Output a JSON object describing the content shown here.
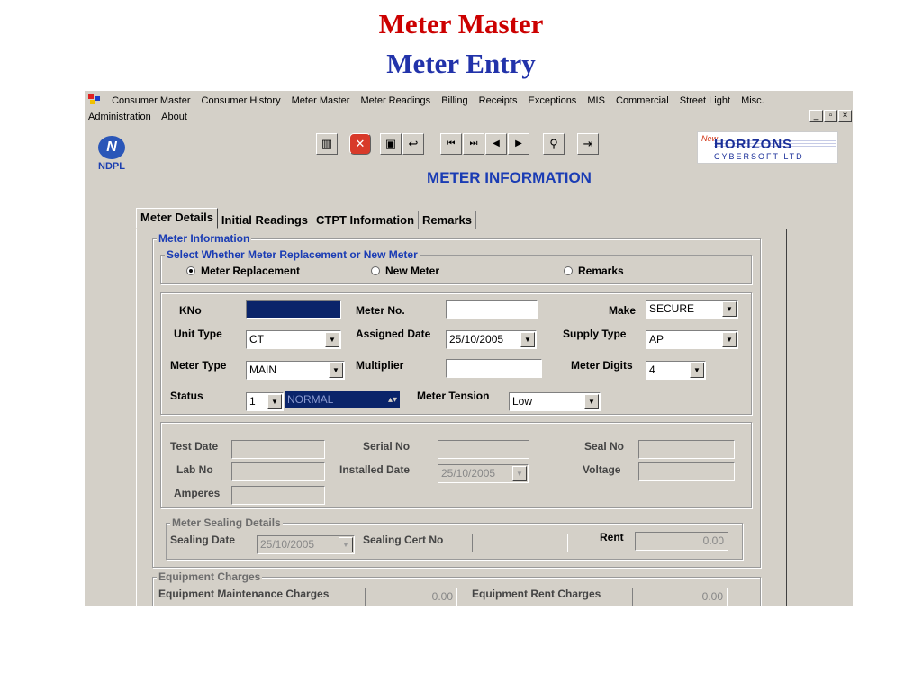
{
  "slide": {
    "title": "Meter Master",
    "subtitle": "Meter Entry"
  },
  "menu": {
    "row1": [
      "Consumer Master",
      "Consumer History",
      "Meter Master",
      "Meter Readings",
      "Billing",
      "Receipts",
      "Exceptions",
      "MIS",
      "Commercial",
      "Street Light",
      "Misc."
    ],
    "row2": [
      "Administration",
      "About"
    ]
  },
  "window_buttons": {
    "minimize": "_",
    "restore": "▫",
    "close": "×"
  },
  "logo": {
    "ndpl": "NDPL",
    "horizons_new": "New",
    "horizons": "HORIZONS",
    "horizons_sub": "CYBERSOFT LTD"
  },
  "heading": "METER INFORMATION",
  "tabs": [
    "Meter Details",
    "Initial Readings",
    "CTPT Information",
    "Remarks"
  ],
  "meter_info": {
    "legend": "Meter Information",
    "select_legend": "Select Whether Meter Replacement or New Meter",
    "options": [
      "Meter Replacement",
      "New Meter",
      "Remarks"
    ],
    "selected_option": "Meter Replacement"
  },
  "fields": {
    "kno_label": "KNo",
    "meter_no_label": "Meter No.",
    "make_label": "Make",
    "make_value": "SECURE",
    "unit_type_label": "Unit Type",
    "unit_type_value": "CT",
    "assigned_date_label": "Assigned Date",
    "assigned_date_value": "25/10/2005",
    "supply_type_label": "Supply Type",
    "supply_type_value": "AP",
    "meter_type_label": "Meter Type",
    "meter_type_value": "MAIN",
    "multiplier_label": "Multiplier",
    "meter_digits_label": "Meter Digits",
    "meter_digits_value": "4",
    "status_label": "Status",
    "status_code": "1",
    "status_value": "NORMAL",
    "meter_tension_label": "Meter Tension",
    "meter_tension_value": "Low"
  },
  "test": {
    "test_date_label": "Test Date",
    "serial_no_label": "Serial No",
    "seal_no_label": "Seal No",
    "lab_no_label": "Lab No",
    "installed_date_label": "Installed Date",
    "installed_date_value": "25/10/2005",
    "voltage_label": "Voltage",
    "amperes_label": "Amperes"
  },
  "sealing": {
    "legend": "Meter Sealing Details",
    "sealing_date_label": "Sealing Date",
    "sealing_date_value": "25/10/2005",
    "sealing_cert_label": "Sealing Cert No",
    "rent_label": "Rent",
    "rent_value": "0.00"
  },
  "equipment": {
    "legend": "Equipment Charges",
    "maintenance_label": "Equipment Maintenance Charges",
    "maintenance_value": "0.00",
    "rent_label": "Equipment Rent Charges",
    "rent_value": "0.00"
  }
}
